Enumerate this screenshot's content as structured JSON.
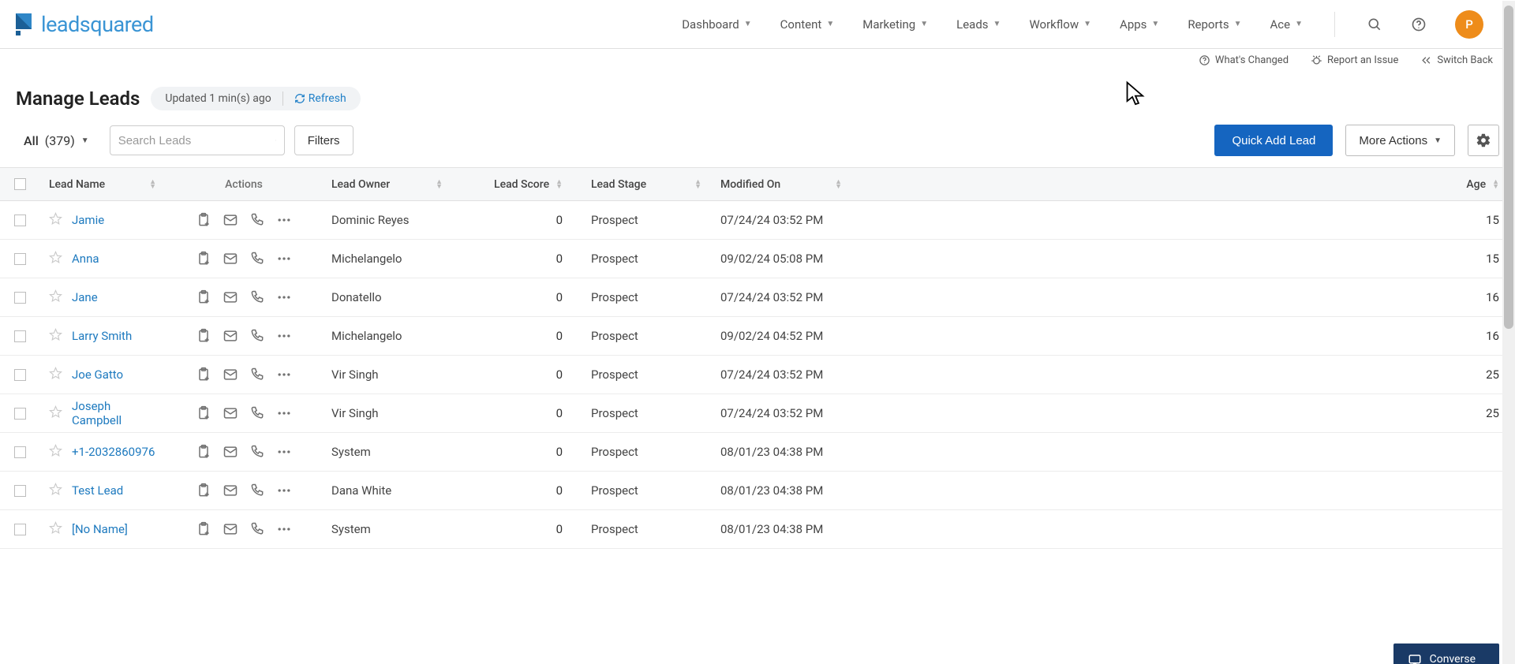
{
  "brand": {
    "name": "leadsquared",
    "avatar_letter": "P"
  },
  "nav": {
    "items": [
      "Dashboard",
      "Content",
      "Marketing",
      "Leads",
      "Workflow",
      "Apps",
      "Reports",
      "Ace"
    ]
  },
  "secbar": {
    "whats_changed": "What's Changed",
    "report_issue": "Report an Issue",
    "switch_back": "Switch Back"
  },
  "page": {
    "title": "Manage Leads",
    "updated_text": "Updated 1 min(s) ago",
    "refresh_label": "Refresh"
  },
  "toolbar": {
    "filter_label": "All",
    "filter_count": "(379)",
    "search_placeholder": "Search Leads",
    "filters_btn": "Filters",
    "quick_add": "Quick Add Lead",
    "more_actions": "More Actions"
  },
  "columns": {
    "name": "Lead Name",
    "actions": "Actions",
    "owner": "Lead Owner",
    "score": "Lead Score",
    "stage": "Lead Stage",
    "modified": "Modified On",
    "age": "Age"
  },
  "rows": [
    {
      "name": "Jamie",
      "owner": "Dominic Reyes",
      "score": "0",
      "stage": "Prospect",
      "modified": "07/24/24 03:52 PM",
      "age": "15"
    },
    {
      "name": "Anna",
      "owner": "Michelangelo",
      "score": "0",
      "stage": "Prospect",
      "modified": "09/02/24 05:08 PM",
      "age": "15"
    },
    {
      "name": "Jane",
      "owner": "Donatello",
      "score": "0",
      "stage": "Prospect",
      "modified": "07/24/24 03:52 PM",
      "age": "16"
    },
    {
      "name": "Larry Smith",
      "owner": "Michelangelo",
      "score": "0",
      "stage": "Prospect",
      "modified": "09/02/24 04:52 PM",
      "age": "16"
    },
    {
      "name": "Joe Gatto",
      "owner": "Vir Singh",
      "score": "0",
      "stage": "Prospect",
      "modified": "07/24/24 03:52 PM",
      "age": "25"
    },
    {
      "name": "Joseph Campbell",
      "owner": "Vir Singh",
      "score": "0",
      "stage": "Prospect",
      "modified": "07/24/24 03:52 PM",
      "age": "25"
    },
    {
      "name": "+1-2032860976",
      "owner": "System",
      "score": "0",
      "stage": "Prospect",
      "modified": "08/01/23 04:38 PM",
      "age": ""
    },
    {
      "name": "Test Lead",
      "owner": "Dana White",
      "score": "0",
      "stage": "Prospect",
      "modified": "08/01/23 04:38 PM",
      "age": ""
    },
    {
      "name": "[No Name]",
      "owner": "System",
      "score": "0",
      "stage": "Prospect",
      "modified": "08/01/23 04:38 PM",
      "age": ""
    }
  ],
  "bottom_button": "Converse"
}
